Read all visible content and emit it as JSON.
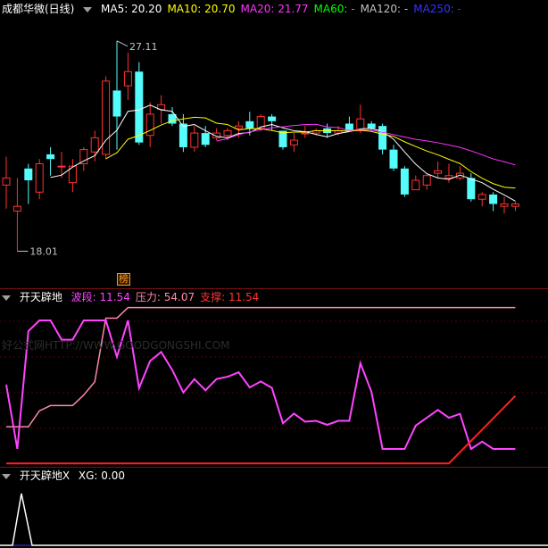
{
  "main": {
    "title": "成都华微(日线)",
    "indicators": [
      {
        "label": "MA5: 20.20",
        "color": "#ffffff"
      },
      {
        "label": "MA10: 20.70",
        "color": "#ffff00"
      },
      {
        "label": "MA20: 21.77",
        "color": "#ff33ff"
      },
      {
        "label": "MA60: -",
        "color": "#00ff00"
      },
      {
        "label": "MA120: -",
        "color": "#c0c0c0"
      },
      {
        "label": "MA250: -",
        "color": "#3333ff"
      }
    ],
    "high_label": "27.11",
    "low_label": "18.01",
    "marker_label": "榜",
    "candles": [
      [
        21.0,
        22.2,
        20.0,
        21.3
      ],
      [
        19.9,
        21.3,
        18.2,
        20.1
      ],
      [
        21.7,
        21.9,
        20.2,
        21.2
      ],
      [
        20.7,
        22.1,
        20.4,
        21.9
      ],
      [
        22.3,
        22.6,
        21.4,
        22.1
      ],
      [
        21.8,
        22.4,
        21.3,
        21.8
      ],
      [
        21.1,
        22.1,
        20.7,
        21.8
      ],
      [
        21.9,
        22.6,
        21.6,
        22.5
      ],
      [
        22.4,
        23.3,
        22.0,
        23.0
      ],
      [
        22.3,
        25.6,
        22.1,
        25.4
      ],
      [
        25.0,
        27.1,
        22.5,
        23.9
      ],
      [
        25.2,
        26.6,
        24.6,
        25.8
      ],
      [
        25.8,
        26.2,
        22.7,
        22.8
      ],
      [
        23.1,
        24.5,
        22.6,
        24.0
      ],
      [
        24.2,
        24.8,
        23.6,
        24.4
      ],
      [
        24.0,
        24.3,
        23.5,
        23.6
      ],
      [
        23.6,
        24.0,
        22.4,
        22.6
      ],
      [
        22.6,
        23.5,
        22.4,
        23.2
      ],
      [
        23.2,
        23.5,
        22.6,
        22.7
      ],
      [
        23.0,
        23.4,
        22.9,
        23.2
      ],
      [
        23.1,
        23.4,
        22.9,
        23.3
      ],
      [
        23.4,
        23.7,
        23.0,
        23.5
      ],
      [
        23.7,
        24.1,
        23.1,
        23.4
      ],
      [
        23.4,
        24.0,
        23.3,
        23.9
      ],
      [
        23.9,
        24.0,
        23.3,
        23.7
      ],
      [
        23.3,
        23.3,
        22.5,
        22.6
      ],
      [
        22.7,
        23.2,
        22.4,
        22.9
      ],
      [
        23.2,
        23.5,
        23.0,
        23.2
      ],
      [
        23.2,
        23.4,
        23.1,
        23.3
      ],
      [
        23.4,
        23.6,
        23.0,
        23.2
      ],
      [
        23.2,
        23.5,
        23.1,
        23.3
      ],
      [
        23.6,
        23.9,
        23.3,
        23.3
      ],
      [
        23.3,
        24.4,
        23.2,
        23.8
      ],
      [
        23.6,
        23.7,
        23.3,
        23.4
      ],
      [
        23.5,
        23.6,
        22.3,
        22.5
      ],
      [
        22.5,
        22.7,
        21.6,
        21.7
      ],
      [
        21.7,
        21.8,
        20.5,
        20.6
      ],
      [
        20.8,
        21.4,
        20.8,
        21.2
      ],
      [
        21.0,
        21.5,
        20.8,
        21.4
      ],
      [
        21.5,
        22.0,
        21.3,
        21.6
      ],
      [
        21.3,
        21.9,
        21.1,
        21.4
      ],
      [
        21.3,
        21.8,
        21.2,
        21.5
      ],
      [
        21.3,
        21.5,
        20.3,
        20.4
      ],
      [
        20.4,
        20.7,
        20.1,
        20.6
      ],
      [
        20.6,
        20.7,
        19.9,
        20.2
      ],
      [
        20.1,
        20.5,
        19.8,
        20.2
      ],
      [
        20.1,
        20.3,
        19.9,
        20.2
      ]
    ]
  },
  "osc": {
    "title": "开天辟地",
    "labels": [
      {
        "text": "波段: 11.54",
        "color": "#ff44ff"
      },
      {
        "text": "压力: 54.07",
        "color": "#ff88aa"
      },
      {
        "text": "支撑: 11.54",
        "color": "#ff3333"
      }
    ],
    "watermark": "好公式网HTTP://WWW.GOODGONGSHI.COM"
  },
  "sig": {
    "title": "开天辟地X",
    "label": "XG: 0.00"
  }
}
